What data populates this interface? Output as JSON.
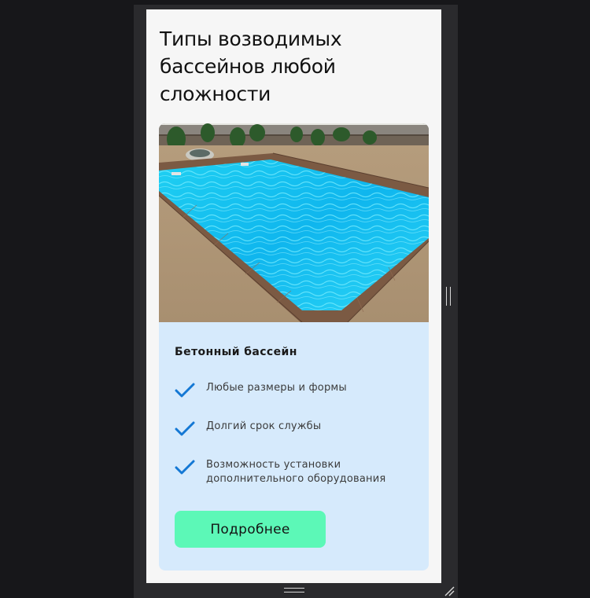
{
  "section": {
    "title": "Типы возводимых бассейнов любой сложности"
  },
  "card": {
    "photo_description": "pool-photo",
    "title": "Бетонный бассейн",
    "features": [
      {
        "icon": "checkmark-icon",
        "text": "Любые размеры и формы"
      },
      {
        "icon": "checkmark-icon",
        "text": "Долгий срок службы"
      },
      {
        "icon": "checkmark-icon",
        "text": "Возможность установки дополнительного оборудования"
      }
    ],
    "button_label": "Подробнее"
  },
  "colors": {
    "page_background": "#17171a",
    "viewport_background": "#f6f6f6",
    "card_background": "#d6eafc",
    "accent_button": "#5cf8b7",
    "check_color": "#1478d4"
  }
}
